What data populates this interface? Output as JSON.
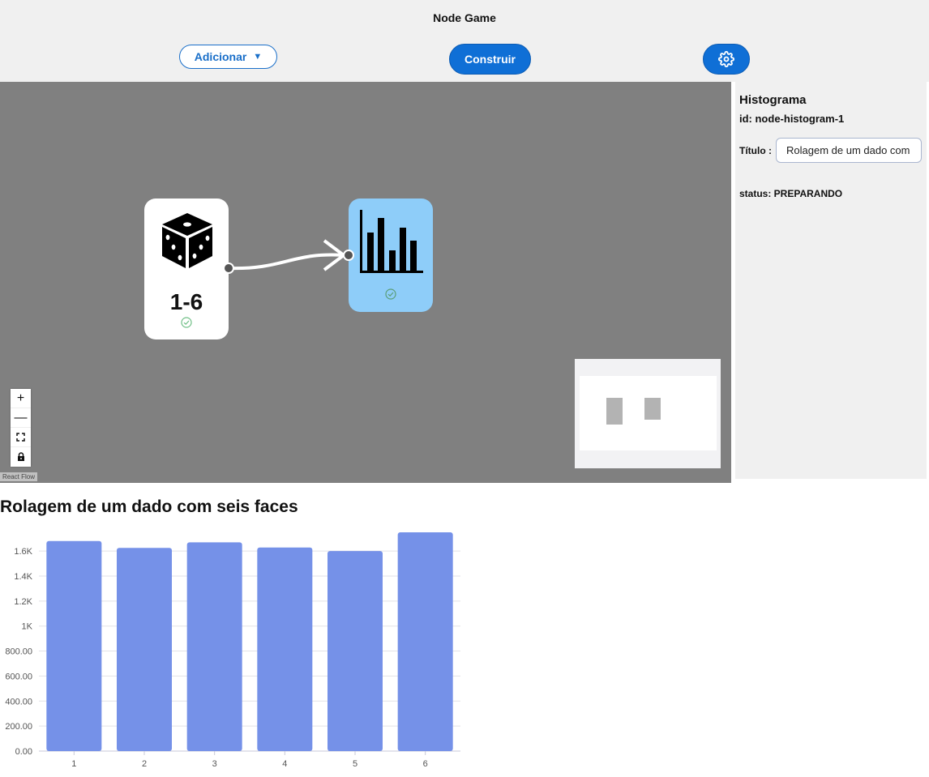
{
  "header": {
    "title": "Node Game",
    "add_label": "Adicionar",
    "add_caret": "▼",
    "build_label": "Construir",
    "settings_icon": "gear-icon",
    "accent": "#0f6fd6"
  },
  "canvas": {
    "background": "#808080",
    "dice_node": {
      "icon": "dice-icon",
      "label": "1-6",
      "status_icon": "check-circle-icon"
    },
    "histogram_node": {
      "icon": "bar-chart-icon",
      "status_icon": "check-circle-icon",
      "color": "#8ecdf9"
    },
    "controls": {
      "zoom_in": "+",
      "zoom_out": "—",
      "fit": "fit-view-icon",
      "lock": "lock-icon"
    },
    "attribution": "React Flow"
  },
  "panel": {
    "title": "Histograma",
    "id_text": "id: node-histogram-1",
    "title_label": "Título :",
    "title_value": "Rolagem de um dado com seis faces",
    "status": "status: PREPARANDO"
  },
  "chart_data": {
    "type": "bar",
    "title": "Rolagem de um dado com seis faces",
    "categories": [
      "1",
      "2",
      "3",
      "4",
      "5",
      "6"
    ],
    "values": [
      1680,
      1625,
      1670,
      1628,
      1600,
      1750
    ],
    "ylim": [
      0,
      1700
    ],
    "yticks": [
      0,
      200,
      400,
      600,
      800,
      1000,
      1200,
      1400,
      1600
    ],
    "ytick_labels": [
      "0.00",
      "200.00",
      "400.00",
      "600.00",
      "800.00",
      "1K",
      "1.2K",
      "1.4K",
      "1.6K"
    ],
    "bar_color": "#7591e8",
    "grid": true
  }
}
